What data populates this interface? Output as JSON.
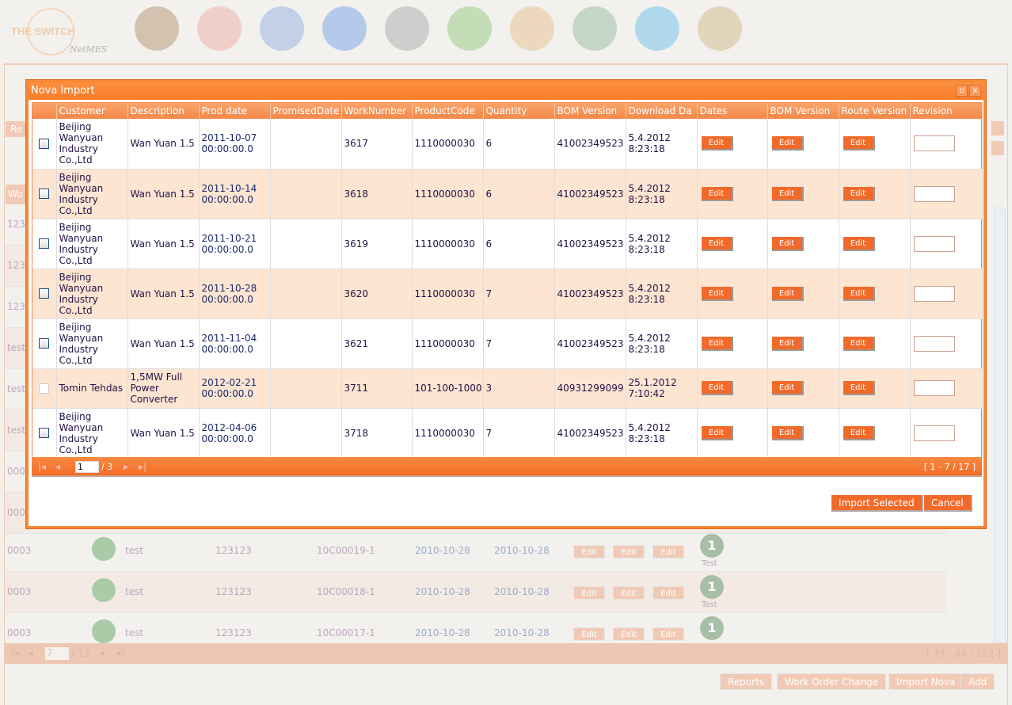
{
  "logo": {
    "name": "THE SWITCH",
    "sub": "NetMES"
  },
  "toolbar": [
    {
      "icon": "home-icon",
      "color": "#a67c52"
    },
    {
      "icon": "pinwheel-icon",
      "color": "#e89a8a"
    },
    {
      "icon": "people-circle-icon",
      "color": "#7aa0d8"
    },
    {
      "icon": "globe-icon",
      "color": "#5a8fe0"
    },
    {
      "icon": "database-icon",
      "color": "#999999"
    },
    {
      "icon": "add-icon",
      "color": "#7cc060"
    },
    {
      "icon": "chart-icon",
      "color": "#e0b070"
    },
    {
      "icon": "users-icon",
      "color": "#7fae8a"
    },
    {
      "icon": "info-icon",
      "color": "#4fb0e0"
    },
    {
      "icon": "lock-icon",
      "color": "#c8aa70"
    }
  ],
  "background": {
    "re_button": "Re",
    "col_header": "Wo",
    "hidden_rows": [
      "123",
      "123",
      "123",
      "test",
      "test",
      "test",
      "000",
      "000"
    ],
    "rows": [
      {
        "id": "0003",
        "name": "test",
        "code": "123123",
        "wo": "10C00019-1",
        "d1": "2010-10-28",
        "d2": "2010-10-28",
        "badge": "1",
        "badge_label": "Test"
      },
      {
        "id": "0003",
        "name": "test",
        "code": "123123",
        "wo": "10C00018-1",
        "d1": "2010-10-28",
        "d2": "2010-10-28",
        "badge": "1",
        "badge_label": "Test"
      },
      {
        "id": "0003",
        "name": "test",
        "code": "123123",
        "wo": "10C00017-1",
        "d1": "2010-10-28",
        "d2": "2010-10-28",
        "badge": "1",
        "badge_label": ""
      }
    ],
    "edit": "Edit",
    "pager": {
      "page": "7",
      "total": "/ 13",
      "range": "[ 73 - 84 / 152 ]"
    },
    "buttons": [
      "Reports",
      "Work Order Change",
      "Import Nova",
      "Add"
    ]
  },
  "dialog": {
    "title": "Nova Import",
    "columns": [
      "",
      "Customer",
      "Description",
      "Prod date",
      "PromisedDate",
      "WorkNumber",
      "ProductCode",
      "Quantity",
      "BOM Version",
      "Download Da",
      "Dates",
      "BOM Version",
      "Route Version",
      "Revision"
    ],
    "edit": "Edit",
    "rows": [
      {
        "customer": "Beijing Wanyuan Industry Co.,Ltd",
        "desc": "Wan Yuan 1.5",
        "prod": "2011-10-07 00:00:00.0",
        "promised": "",
        "work": "3617",
        "product": "1110000030",
        "qty": "6",
        "bom": "41002349523",
        "download": "5.4.2012 8:23:18",
        "revision": ""
      },
      {
        "customer": "Beijing Wanyuan Industry Co.,Ltd",
        "desc": "Wan Yuan 1.5",
        "prod": "2011-10-14 00:00:00.0",
        "promised": "",
        "work": "3618",
        "product": "1110000030",
        "qty": "6",
        "bom": "41002349523",
        "download": "5.4.2012 8:23:18",
        "revision": ""
      },
      {
        "customer": "Beijing Wanyuan Industry Co.,Ltd",
        "desc": "Wan Yuan 1.5",
        "prod": "2011-10-21 00:00:00.0",
        "promised": "",
        "work": "3619",
        "product": "1110000030",
        "qty": "6",
        "bom": "41002349523",
        "download": "5.4.2012 8:23:18",
        "revision": ""
      },
      {
        "customer": "Beijing Wanyuan Industry Co.,Ltd",
        "desc": "Wan Yuan 1.5",
        "prod": "2011-10-28 00:00:00.0",
        "promised": "",
        "work": "3620",
        "product": "1110000030",
        "qty": "7",
        "bom": "41002349523",
        "download": "5.4.2012 8:23:18",
        "revision": ""
      },
      {
        "customer": "Beijing Wanyuan Industry Co.,Ltd",
        "desc": "Wan Yuan 1.5",
        "prod": "2011-11-04 00:00:00.0",
        "promised": "",
        "work": "3621",
        "product": "1110000030",
        "qty": "7",
        "bom": "41002349523",
        "download": "5.4.2012 8:23:18",
        "revision": ""
      },
      {
        "customer": "Tomin Tehdas",
        "desc": "1,5MW Full Power Converter",
        "prod": "2012-02-21 00:00:00.0",
        "promised": "",
        "work": "3711",
        "product": "101-100-1000",
        "qty": "3",
        "bom": "40931299099",
        "download": "25.1.2012 7:10:42",
        "revision": ""
      },
      {
        "customer": "Beijing Wanyuan Industry Co.,Ltd",
        "desc": "Wan Yuan 1.5",
        "prod": "2012-04-06 00:00:00.0",
        "promised": "",
        "work": "3718",
        "product": "1110000030",
        "qty": "7",
        "bom": "41002349523",
        "download": "5.4.2012 8:23:18",
        "revision": ""
      }
    ],
    "pager": {
      "page": "1",
      "total": "/ 3",
      "range": "[ 1 - 7 / 17 ]"
    },
    "import_label": "Import Selected",
    "cancel_label": "Cancel"
  }
}
